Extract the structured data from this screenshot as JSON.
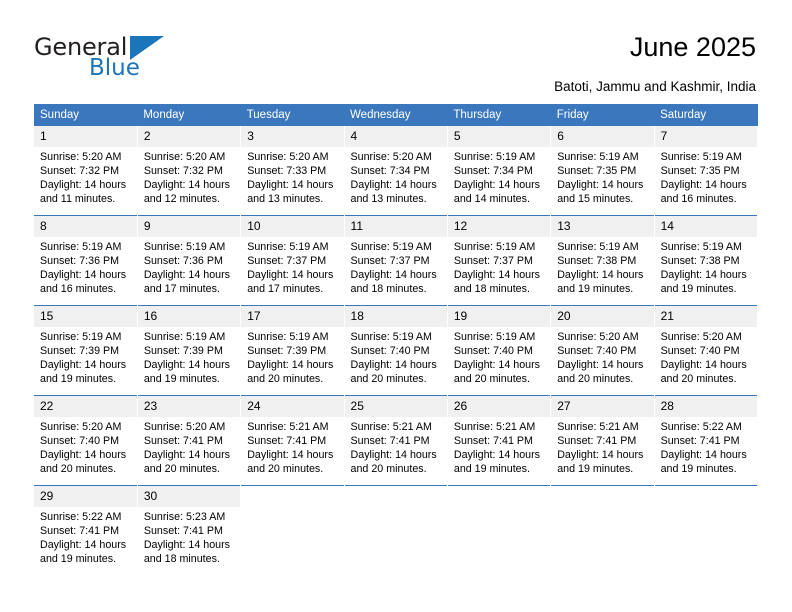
{
  "logo": {
    "word_dark": "General",
    "word_blue": "Blue",
    "triangle_icon": "blue-triangle-icon",
    "brand_color": "#1b75bb"
  },
  "header": {
    "title": "June 2025",
    "subtitle": "Batoti, Jammu and Kashmir, India"
  },
  "colors": {
    "header_row": "#3b77bd",
    "daynum_band": "#f0f0f0",
    "text": "#000000"
  },
  "calendar": {
    "weekday_headers": [
      "Sunday",
      "Monday",
      "Tuesday",
      "Wednesday",
      "Thursday",
      "Friday",
      "Saturday"
    ],
    "weeks": [
      [
        {
          "day": "1",
          "sunrise": "Sunrise: 5:20 AM",
          "sunset": "Sunset: 7:32 PM",
          "daylight1": "Daylight: 14 hours",
          "daylight2": "and 11 minutes."
        },
        {
          "day": "2",
          "sunrise": "Sunrise: 5:20 AM",
          "sunset": "Sunset: 7:32 PM",
          "daylight1": "Daylight: 14 hours",
          "daylight2": "and 12 minutes."
        },
        {
          "day": "3",
          "sunrise": "Sunrise: 5:20 AM",
          "sunset": "Sunset: 7:33 PM",
          "daylight1": "Daylight: 14 hours",
          "daylight2": "and 13 minutes."
        },
        {
          "day": "4",
          "sunrise": "Sunrise: 5:20 AM",
          "sunset": "Sunset: 7:34 PM",
          "daylight1": "Daylight: 14 hours",
          "daylight2": "and 13 minutes."
        },
        {
          "day": "5",
          "sunrise": "Sunrise: 5:19 AM",
          "sunset": "Sunset: 7:34 PM",
          "daylight1": "Daylight: 14 hours",
          "daylight2": "and 14 minutes."
        },
        {
          "day": "6",
          "sunrise": "Sunrise: 5:19 AM",
          "sunset": "Sunset: 7:35 PM",
          "daylight1": "Daylight: 14 hours",
          "daylight2": "and 15 minutes."
        },
        {
          "day": "7",
          "sunrise": "Sunrise: 5:19 AM",
          "sunset": "Sunset: 7:35 PM",
          "daylight1": "Daylight: 14 hours",
          "daylight2": "and 16 minutes."
        }
      ],
      [
        {
          "day": "8",
          "sunrise": "Sunrise: 5:19 AM",
          "sunset": "Sunset: 7:36 PM",
          "daylight1": "Daylight: 14 hours",
          "daylight2": "and 16 minutes."
        },
        {
          "day": "9",
          "sunrise": "Sunrise: 5:19 AM",
          "sunset": "Sunset: 7:36 PM",
          "daylight1": "Daylight: 14 hours",
          "daylight2": "and 17 minutes."
        },
        {
          "day": "10",
          "sunrise": "Sunrise: 5:19 AM",
          "sunset": "Sunset: 7:37 PM",
          "daylight1": "Daylight: 14 hours",
          "daylight2": "and 17 minutes."
        },
        {
          "day": "11",
          "sunrise": "Sunrise: 5:19 AM",
          "sunset": "Sunset: 7:37 PM",
          "daylight1": "Daylight: 14 hours",
          "daylight2": "and 18 minutes."
        },
        {
          "day": "12",
          "sunrise": "Sunrise: 5:19 AM",
          "sunset": "Sunset: 7:37 PM",
          "daylight1": "Daylight: 14 hours",
          "daylight2": "and 18 minutes."
        },
        {
          "day": "13",
          "sunrise": "Sunrise: 5:19 AM",
          "sunset": "Sunset: 7:38 PM",
          "daylight1": "Daylight: 14 hours",
          "daylight2": "and 19 minutes."
        },
        {
          "day": "14",
          "sunrise": "Sunrise: 5:19 AM",
          "sunset": "Sunset: 7:38 PM",
          "daylight1": "Daylight: 14 hours",
          "daylight2": "and 19 minutes."
        }
      ],
      [
        {
          "day": "15",
          "sunrise": "Sunrise: 5:19 AM",
          "sunset": "Sunset: 7:39 PM",
          "daylight1": "Daylight: 14 hours",
          "daylight2": "and 19 minutes."
        },
        {
          "day": "16",
          "sunrise": "Sunrise: 5:19 AM",
          "sunset": "Sunset: 7:39 PM",
          "daylight1": "Daylight: 14 hours",
          "daylight2": "and 19 minutes."
        },
        {
          "day": "17",
          "sunrise": "Sunrise: 5:19 AM",
          "sunset": "Sunset: 7:39 PM",
          "daylight1": "Daylight: 14 hours",
          "daylight2": "and 20 minutes."
        },
        {
          "day": "18",
          "sunrise": "Sunrise: 5:19 AM",
          "sunset": "Sunset: 7:40 PM",
          "daylight1": "Daylight: 14 hours",
          "daylight2": "and 20 minutes."
        },
        {
          "day": "19",
          "sunrise": "Sunrise: 5:19 AM",
          "sunset": "Sunset: 7:40 PM",
          "daylight1": "Daylight: 14 hours",
          "daylight2": "and 20 minutes."
        },
        {
          "day": "20",
          "sunrise": "Sunrise: 5:20 AM",
          "sunset": "Sunset: 7:40 PM",
          "daylight1": "Daylight: 14 hours",
          "daylight2": "and 20 minutes."
        },
        {
          "day": "21",
          "sunrise": "Sunrise: 5:20 AM",
          "sunset": "Sunset: 7:40 PM",
          "daylight1": "Daylight: 14 hours",
          "daylight2": "and 20 minutes."
        }
      ],
      [
        {
          "day": "22",
          "sunrise": "Sunrise: 5:20 AM",
          "sunset": "Sunset: 7:40 PM",
          "daylight1": "Daylight: 14 hours",
          "daylight2": "and 20 minutes."
        },
        {
          "day": "23",
          "sunrise": "Sunrise: 5:20 AM",
          "sunset": "Sunset: 7:41 PM",
          "daylight1": "Daylight: 14 hours",
          "daylight2": "and 20 minutes."
        },
        {
          "day": "24",
          "sunrise": "Sunrise: 5:21 AM",
          "sunset": "Sunset: 7:41 PM",
          "daylight1": "Daylight: 14 hours",
          "daylight2": "and 20 minutes."
        },
        {
          "day": "25",
          "sunrise": "Sunrise: 5:21 AM",
          "sunset": "Sunset: 7:41 PM",
          "daylight1": "Daylight: 14 hours",
          "daylight2": "and 20 minutes."
        },
        {
          "day": "26",
          "sunrise": "Sunrise: 5:21 AM",
          "sunset": "Sunset: 7:41 PM",
          "daylight1": "Daylight: 14 hours",
          "daylight2": "and 19 minutes."
        },
        {
          "day": "27",
          "sunrise": "Sunrise: 5:21 AM",
          "sunset": "Sunset: 7:41 PM",
          "daylight1": "Daylight: 14 hours",
          "daylight2": "and 19 minutes."
        },
        {
          "day": "28",
          "sunrise": "Sunrise: 5:22 AM",
          "sunset": "Sunset: 7:41 PM",
          "daylight1": "Daylight: 14 hours",
          "daylight2": "and 19 minutes."
        }
      ],
      [
        {
          "day": "29",
          "sunrise": "Sunrise: 5:22 AM",
          "sunset": "Sunset: 7:41 PM",
          "daylight1": "Daylight: 14 hours",
          "daylight2": "and 19 minutes."
        },
        {
          "day": "30",
          "sunrise": "Sunrise: 5:23 AM",
          "sunset": "Sunset: 7:41 PM",
          "daylight1": "Daylight: 14 hours",
          "daylight2": "and 18 minutes."
        },
        {
          "day": "",
          "sunrise": "",
          "sunset": "",
          "daylight1": "",
          "daylight2": ""
        },
        {
          "day": "",
          "sunrise": "",
          "sunset": "",
          "daylight1": "",
          "daylight2": ""
        },
        {
          "day": "",
          "sunrise": "",
          "sunset": "",
          "daylight1": "",
          "daylight2": ""
        },
        {
          "day": "",
          "sunrise": "",
          "sunset": "",
          "daylight1": "",
          "daylight2": ""
        },
        {
          "day": "",
          "sunrise": "",
          "sunset": "",
          "daylight1": "",
          "daylight2": ""
        }
      ]
    ]
  }
}
